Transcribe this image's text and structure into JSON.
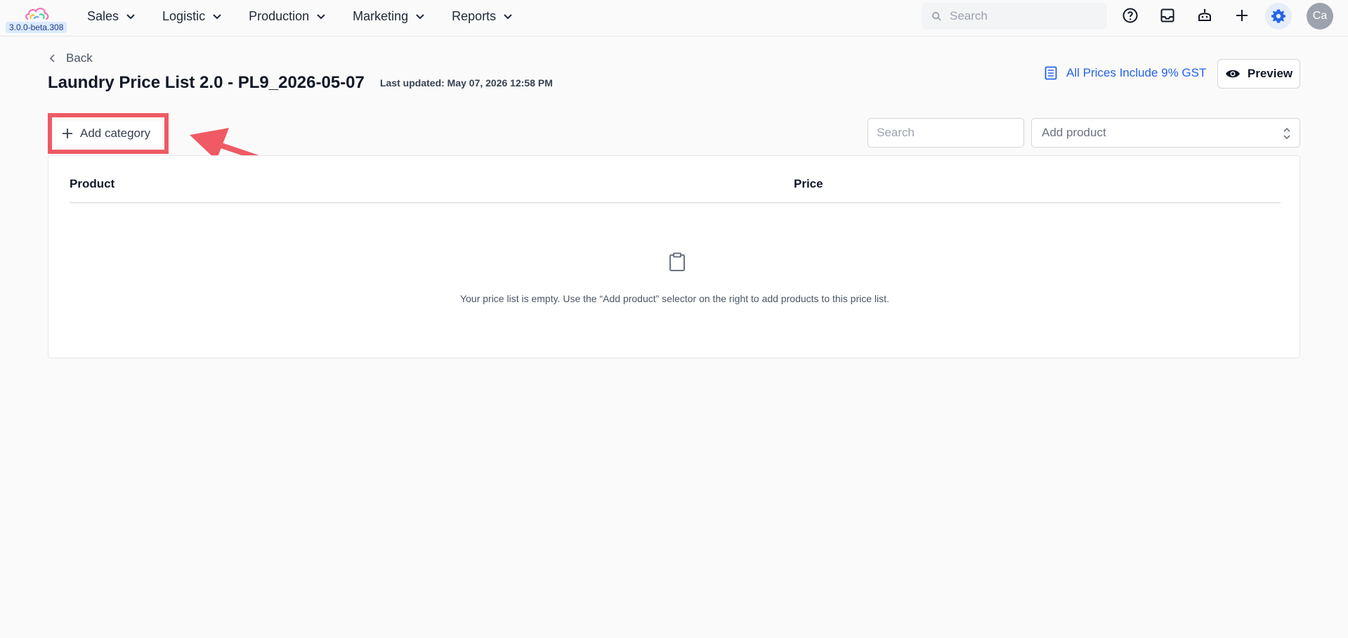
{
  "app": {
    "version": "3.0.0-beta.308",
    "accent_color": "#2563eb",
    "highlight_color": "#ef5a64"
  },
  "nav": {
    "items": [
      {
        "label": "Sales"
      },
      {
        "label": "Logistic"
      },
      {
        "label": "Production"
      },
      {
        "label": "Marketing"
      },
      {
        "label": "Reports"
      }
    ],
    "search_placeholder": "Search",
    "avatar_initials": "Ca"
  },
  "page": {
    "back_label": "Back",
    "title": "Laundry Price List 2.0 - PL9_2026-05-07",
    "last_updated": "Last updated: May 07, 2026 12:58 PM",
    "gst_label": "All Prices Include 9% GST",
    "preview_label": "Preview"
  },
  "toolbar": {
    "add_category_label": "Add category",
    "search_placeholder": "Search",
    "add_product_placeholder": "Add product"
  },
  "table": {
    "columns": [
      "Product",
      "Price"
    ],
    "empty_message": "Your price list is empty. Use the “Add product” selector on the right to add products to this price list."
  }
}
